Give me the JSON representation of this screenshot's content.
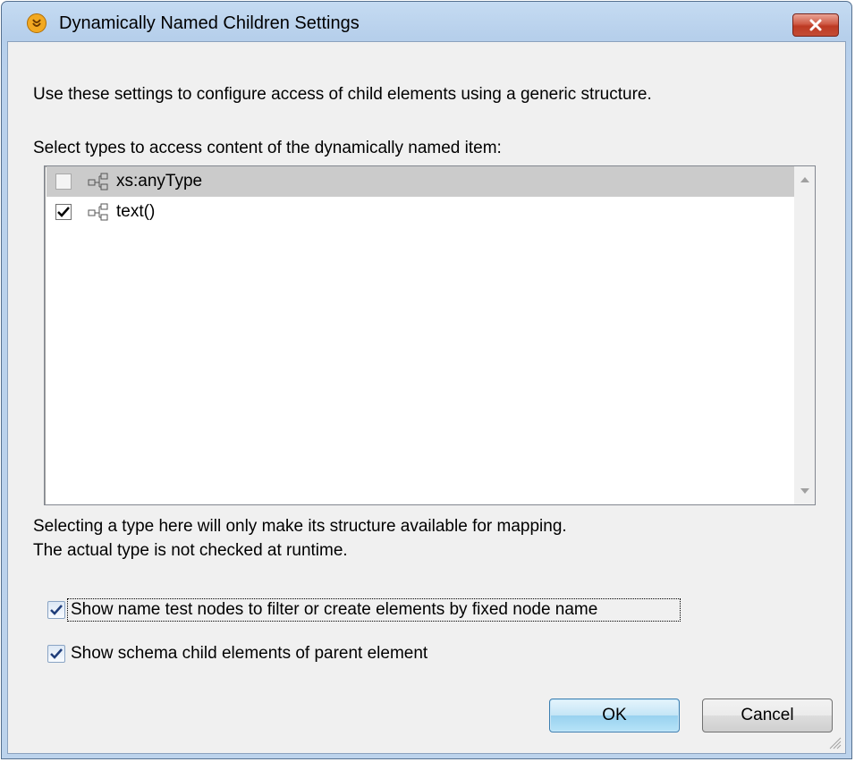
{
  "window": {
    "title": "Dynamically Named Children Settings",
    "app_icon": "altova-mapforce-icon",
    "close_icon": "close-icon"
  },
  "intro_text": "Use these settings to configure access of child elements using a generic structure.",
  "list_label": "Select types to access content of the dynamically named item:",
  "types_list": {
    "items": [
      {
        "label": "xs:anyType",
        "checked": false,
        "enabled": false,
        "selected": true,
        "icon": "element-node-icon"
      },
      {
        "label": "text()",
        "checked": true,
        "enabled": true,
        "selected": false,
        "icon": "element-node-icon"
      }
    ]
  },
  "note": {
    "line1": "Selecting a type here will only make its structure available for mapping.",
    "line2": "The actual type is not checked at runtime."
  },
  "options": {
    "show_name_test_nodes": {
      "label": "Show name test nodes to filter or create elements by fixed node name",
      "checked": true
    },
    "show_schema_children": {
      "label": "Show schema child elements of parent element",
      "checked": true
    }
  },
  "buttons": {
    "ok": "OK",
    "cancel": "Cancel"
  },
  "colors": {
    "titlebar": "#b9d1ec",
    "close_button": "#c44c35",
    "dialog_face": "#f0f0f0",
    "selection": "#cbcbcb"
  }
}
